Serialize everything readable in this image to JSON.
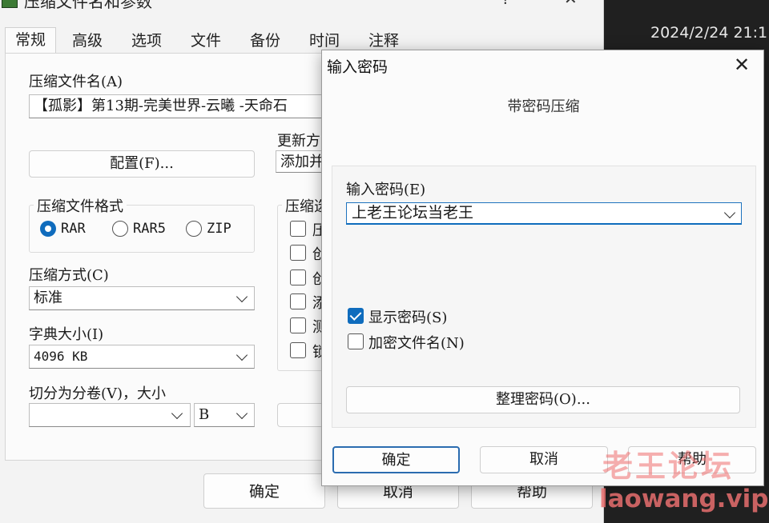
{
  "taskbar": {
    "clock": "2024/2/24 21:1"
  },
  "main_dialog": {
    "title": "压缩文件名和参数",
    "help_button": "?",
    "close_button": "✕",
    "tabs": [
      "常规",
      "高级",
      "选项",
      "文件",
      "备份",
      "时间",
      "注释"
    ],
    "archive_name_label": "压缩文件名(A)",
    "archive_name_value": "【孤影】第13期-完美世界-云曦 -天命石",
    "update_mode_label": "更新方",
    "update_mode_value": "添加并",
    "profiles_button": "配置(F)...",
    "format_group_title": "压缩文件格式",
    "formats": [
      "RAR",
      "RAR5",
      "ZIP"
    ],
    "selected_format": "RAR",
    "options_group_title": "压缩选",
    "option_partials": [
      "压",
      "创",
      "创",
      "添",
      "测",
      "锁"
    ],
    "method_label": "压缩方式(C)",
    "method_value": "标准",
    "dict_label": "字典大小(I)",
    "dict_value": "4096 KB",
    "volume_label": "切分为分卷(V)，大小",
    "volume_value": "",
    "volume_unit": "B",
    "ok_button": "确定",
    "cancel_button": "取消",
    "help_button_bottom": "帮助"
  },
  "password_dialog": {
    "title": "输入密码",
    "close_button": "✕",
    "subtitle": "带密码压缩",
    "password_label": "输入密码(E)",
    "password_value": "上老王论坛当老王",
    "show_password_label": "显示密码(S)",
    "show_password_checked": true,
    "encrypt_names_label": "加密文件名(N)",
    "encrypt_names_checked": false,
    "organize_button": "整理密码(O)...",
    "ok_button": "确定",
    "cancel_button": "取消",
    "help_button": "帮助"
  },
  "watermark": {
    "chinese": "老王论坛",
    "url": "laowang.vip"
  },
  "colors": {
    "accent": "#0f6cbd",
    "watermark": "#e86e6e",
    "window_bg": "#f3f3f3"
  },
  "icons": [
    "winrar-icon",
    "close-icon",
    "chevron-down-icon",
    "radio-icon",
    "checkbox-icon"
  ]
}
